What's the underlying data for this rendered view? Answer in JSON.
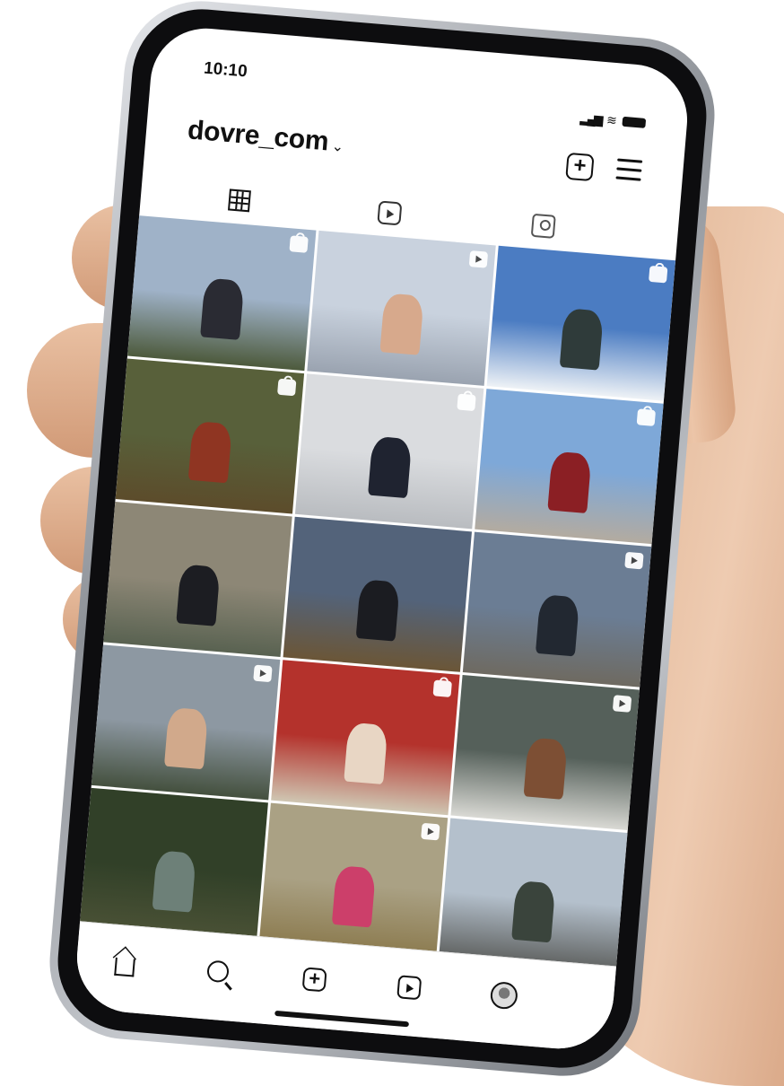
{
  "status_bar": {
    "time": "10:10"
  },
  "profile_header": {
    "username": "dovre_com",
    "chevron": "⌄"
  },
  "tabs": [
    "grid",
    "reels",
    "tagged"
  ],
  "posts": [
    {
      "scene": "two people sitting by a lake",
      "badge": "shop",
      "sky": "#9fb2c8",
      "ground": "#4d5a3c",
      "figure": "#2a2b33"
    },
    {
      "scene": "smiling woman in grey top",
      "badge": "reel",
      "sky": "#c9d2de",
      "ground": "#9aa3b0",
      "figure": "#d7a98c"
    },
    {
      "scene": "skier on snowy mountain",
      "badge": "shop",
      "sky": "#4b7cc2",
      "ground": "#eef2f6",
      "figure": "#2f3b3a"
    },
    {
      "scene": "person sitting in forest",
      "badge": "shop",
      "sky": "#58603a",
      "ground": "#5c4c2b",
      "figure": "#8f3522"
    },
    {
      "scene": "woman climbing wall",
      "badge": "shop",
      "sky": "#dadcdf",
      "ground": "#b9bcc0",
      "figure": "#1f2330"
    },
    {
      "scene": "woman in red by building",
      "badge": "shop",
      "sky": "#7ea8d8",
      "ground": "#b3aba0",
      "figure": "#8b1f24"
    },
    {
      "scene": "man with backpack by truck",
      "badge": "",
      "sky": "#8d8776",
      "ground": "#596251",
      "figure": "#1c1d22"
    },
    {
      "scene": "woman with musk ox",
      "badge": "",
      "sky": "#53637a",
      "ground": "#6b5637",
      "figure": "#1b1c21"
    },
    {
      "scene": "person on rocky summit",
      "badge": "reel",
      "sky": "#6b7d94",
      "ground": "#6e6a61",
      "figure": "#222831"
    },
    {
      "scene": "smiling man in beanie",
      "badge": "reel",
      "sky": "#8d98a2",
      "ground": "#44503e",
      "figure": "#d1a98b"
    },
    {
      "scene": "woman in hammock tent",
      "badge": "shop",
      "sky": "#b4322c",
      "ground": "#cfc6b2",
      "figure": "#e8d6c4"
    },
    {
      "scene": "man in white tee",
      "badge": "reel",
      "sky": "#55605a",
      "ground": "#d9d9d4",
      "figure": "#7d4f34"
    },
    {
      "scene": "man in forest",
      "badge": "",
      "sky": "#314028",
      "ground": "#4b5236",
      "figure": "#6d8078"
    },
    {
      "scene": "person in pink hammock",
      "badge": "reel",
      "sky": "#aaa184",
      "ground": "#8b7a4e",
      "figure": "#cc3f6a"
    },
    {
      "scene": "man on mountain",
      "badge": "",
      "sky": "#b4c0cc",
      "ground": "#5c5e5c",
      "figure": "#3a443c"
    }
  ],
  "bottom_nav": [
    "home",
    "search",
    "create",
    "reels",
    "profile"
  ],
  "colors": {
    "text": "#111111",
    "skin": "#dcae8f",
    "frame": "#0d0d0f"
  }
}
